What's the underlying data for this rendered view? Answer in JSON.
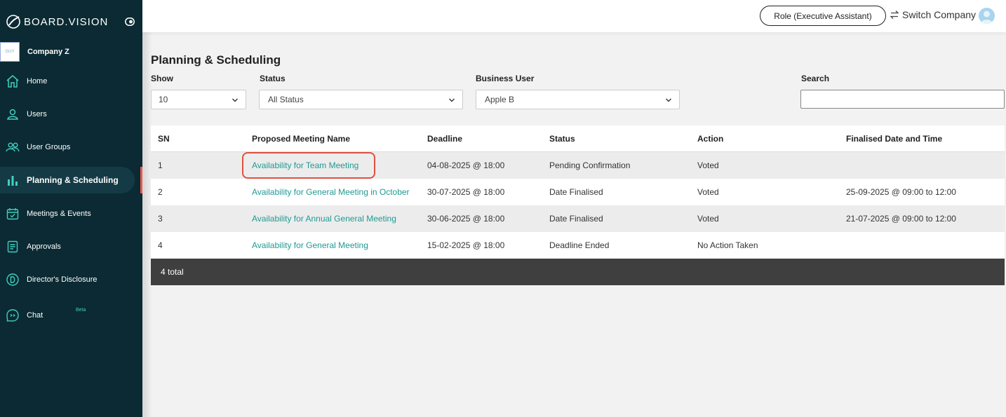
{
  "brand": {
    "name": "BOARD.VISION"
  },
  "company": {
    "name": "Company Z",
    "logo_text": "GUY"
  },
  "sidebar": {
    "items": [
      {
        "label": "Home",
        "icon": "home-icon"
      },
      {
        "label": "Users",
        "icon": "user-icon"
      },
      {
        "label": "User Groups",
        "icon": "user-group-icon"
      },
      {
        "label": "Planning & Scheduling",
        "icon": "bar-chart-icon",
        "active": true
      },
      {
        "label": "Meetings & Events",
        "icon": "calendar-icon"
      },
      {
        "label": "Approvals",
        "icon": "document-icon"
      },
      {
        "label": "Director's Disclosure",
        "icon": "disclosure-d-icon"
      },
      {
        "label": "Chat",
        "icon": "chat-icon",
        "badge": "Beta"
      }
    ],
    "accent": "#e85a4f",
    "background": "#0b2a33"
  },
  "topbar": {
    "role_label": "Role (Executive Assistant)",
    "switch_label": "Switch Company"
  },
  "page": {
    "title": "Planning & Scheduling",
    "filters": {
      "show_label": "Show",
      "show_value": "10",
      "status_label": "Status",
      "status_value": "All Status",
      "business_user_label": "Business User",
      "business_user_value": "Apple B",
      "search_label": "Search",
      "search_value": ""
    }
  },
  "table": {
    "columns": [
      "SN",
      "Proposed Meeting Name",
      "Deadline",
      "Status",
      "Action",
      "Finalised Date and Time"
    ],
    "rows": [
      {
        "sn": "1",
        "name": "Availability for Team Meeting",
        "deadline": "04-08-2025 @ 18:00",
        "status": "Pending Confirmation",
        "action": "Voted",
        "finalised": ""
      },
      {
        "sn": "2",
        "name": "Availability for General Meeting in October",
        "deadline": "30-07-2025 @ 18:00",
        "status": "Date Finalised",
        "action": "Voted",
        "finalised": "25-09-2025 @ 09:00 to 12:00"
      },
      {
        "sn": "3",
        "name": "Availability for Annual General Meeting",
        "deadline": "30-06-2025 @ 18:00",
        "status": "Date Finalised",
        "action": "Voted",
        "finalised": "21-07-2025 @ 09:00 to 12:00"
      },
      {
        "sn": "4",
        "name": "Availability for General Meeting",
        "deadline": "15-02-2025 @ 18:00",
        "status": "Deadline Ended",
        "action": "No Action Taken",
        "finalised": ""
      }
    ],
    "footer": "4 total",
    "link_color": "#1f9a93",
    "highlight_color": "#e0503f"
  }
}
